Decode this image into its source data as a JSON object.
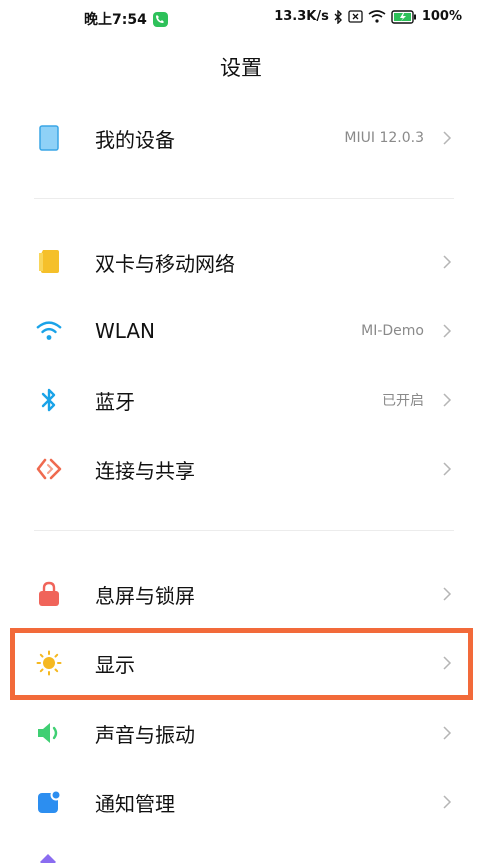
{
  "status_bar": {
    "time": "晚上7:54",
    "net_speed": "13.3K/s",
    "battery": "100%"
  },
  "page": {
    "title": "设置"
  },
  "items": [
    {
      "label": "我的设备",
      "value": "MIUI 12.0.3",
      "icon": "phone-icon"
    },
    {
      "label": "双卡与移动网络",
      "value": "",
      "icon": "sim-card-icon"
    },
    {
      "label": "WLAN",
      "value": "MI-Demo",
      "icon": "wifi-icon"
    },
    {
      "label": "蓝牙",
      "value": "已开启",
      "icon": "bluetooth-icon"
    },
    {
      "label": "连接与共享",
      "value": "",
      "icon": "connection-share-icon"
    },
    {
      "label": "息屏与锁屏",
      "value": "",
      "icon": "lock-icon"
    },
    {
      "label": "显示",
      "value": "",
      "icon": "sun-icon"
    },
    {
      "label": "声音与振动",
      "value": "",
      "icon": "speaker-icon"
    },
    {
      "label": "通知管理",
      "value": "",
      "icon": "notification-icon"
    }
  ],
  "colors": {
    "highlight": "#f26a3a",
    "wifi": "#1aa3e8",
    "sim": "#f5c02a",
    "lock": "#f0645a",
    "sun": "#f5b820",
    "speaker": "#3fcf73",
    "notification": "#2c8ef0"
  }
}
